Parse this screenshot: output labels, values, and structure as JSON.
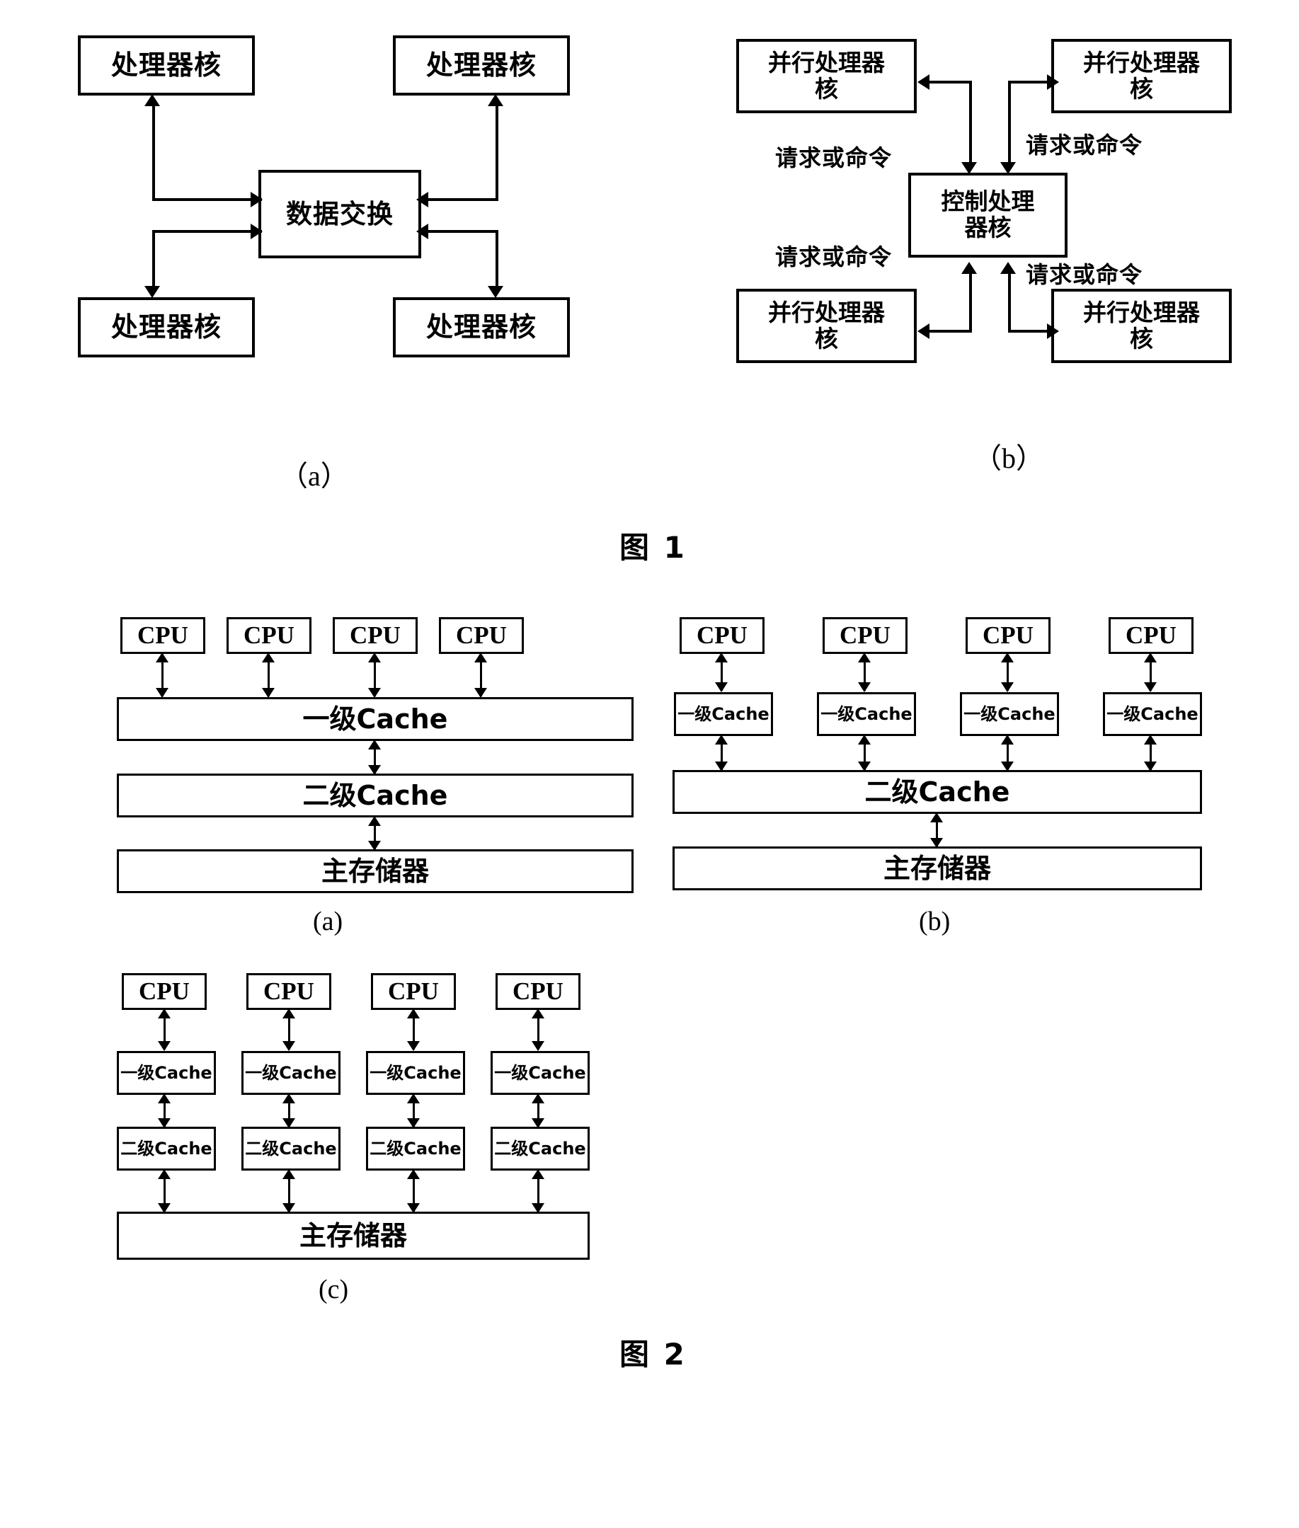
{
  "figure1": {
    "caption": "图  1",
    "sub_a": "（a）",
    "sub_b": "（b）",
    "a": {
      "center_label": "数据交换",
      "cores": [
        {
          "label": "处理器核"
        },
        {
          "label": "处理器核"
        },
        {
          "label": "处理器核"
        },
        {
          "label": "处理器核"
        }
      ]
    },
    "b": {
      "center_label": "控制处理\n器核",
      "center_line1": "控制处理",
      "center_line2": "器核",
      "parallel_label_line1": "并行处理器",
      "parallel_label_line2": "核",
      "cores": [
        {
          "line1": "并行处理器",
          "line2": "核"
        },
        {
          "line1": "并行处理器",
          "line2": "核"
        },
        {
          "line1": "并行处理器",
          "line2": "核"
        },
        {
          "line1": "并行处理器",
          "line2": "核"
        }
      ],
      "edge_labels": [
        "请求或命令",
        "请求或命令",
        "请求或命令",
        "请求或命令"
      ]
    }
  },
  "figure2": {
    "caption": "图  2",
    "sub_a": "(a)",
    "sub_b": "(b)",
    "sub_c": "(c)",
    "cpu_label": "CPU",
    "l1_label": "一级Cache",
    "l2_label": "二级Cache",
    "mem_label": "主存储器",
    "a": {
      "cpus": [
        "CPU",
        "CPU",
        "CPU",
        "CPU"
      ],
      "l1": "一级Cache",
      "l2": "二级Cache",
      "mem": "主存储器"
    },
    "b": {
      "cpus": [
        "CPU",
        "CPU",
        "CPU",
        "CPU"
      ],
      "l1s": [
        "一级Cache",
        "一级Cache",
        "一级Cache",
        "一级Cache"
      ],
      "l2": "二级Cache",
      "mem": "主存储器"
    },
    "c": {
      "cpus": [
        "CPU",
        "CPU",
        "CPU",
        "CPU"
      ],
      "l1s": [
        "一级Cache",
        "一级Cache",
        "一级Cache",
        "一级Cache"
      ],
      "l2s": [
        "二级Cache",
        "二级Cache",
        "二级Cache",
        "二级Cache"
      ],
      "mem": "主存储器"
    }
  },
  "colors": {
    "ink": "#000000",
    "paper": "#ffffff"
  }
}
